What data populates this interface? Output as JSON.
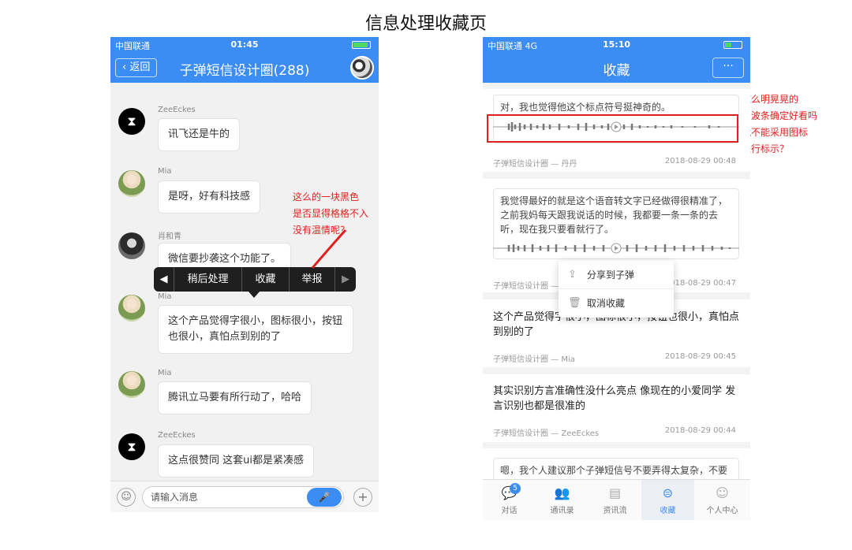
{
  "page_title": "信息处理收藏页",
  "chat_screen": {
    "status": {
      "carrier": "中国联通",
      "time": "01:45"
    },
    "nav": {
      "back_label": "返回",
      "title": "子弹短信设计圈(288)"
    },
    "messages": [
      {
        "sender": "ZeeEckes",
        "text": "讯飞还是牛的"
      },
      {
        "sender": "Mia",
        "text": "是呀，好有科技感"
      },
      {
        "sender": "肖和青",
        "text": "微信要抄袭这个功能了。"
      },
      {
        "sender": "Mia",
        "text": "这个产品觉得字很小，图标很小，按钮也很小，真怕点到别的了"
      },
      {
        "sender": "Mia",
        "text": "腾讯立马要有所行动了，哈哈"
      },
      {
        "sender": "ZeeEckes",
        "text": "这点很赞同 这套ui都是紧凑感"
      }
    ],
    "context_menu": {
      "items": [
        "稍后处理",
        "收藏",
        "举报"
      ]
    },
    "input": {
      "placeholder": "请输入消息"
    }
  },
  "annotations": {
    "left_note_lines": [
      "这么的一块黑色",
      "是否显得格格不入",
      "没有温情呢？"
    ],
    "right_note_lines": [
      "这么明晃晃的",
      "声波条确定好看吗",
      "就不能采用图标",
      "进行标示？"
    ]
  },
  "favorites_screen": {
    "status": {
      "carrier": "中国联通",
      "network": "4G",
      "time": "15:10"
    },
    "nav": {
      "title": "收藏",
      "more_label": "···"
    },
    "items": [
      {
        "quote": "对，我也觉得他这个标点符号挺神奇的。",
        "source": "子弹短信设计圈 — 丹丹",
        "time": "2018-08-29 00:48"
      },
      {
        "quote": "我觉得最好的就是这个语音转文字已经做得很精准了，之前我妈每天跟我说话的时候，我都要一条一条的去听，现在我只要看就行了。",
        "source": "子弹短信设计圈 — 子弹",
        "time": "2018-08-29 00:47"
      },
      {
        "text": "这个产品觉得字很小，图标很小，按钮也很小，真怕点到别的了",
        "source": "子弹短信设计圈 — Mia",
        "time": "2018-08-29 00:45"
      },
      {
        "text": "其实识别方言准确性没什么亮点 像现在的小爱同学 发言识别也都是很准的",
        "source": "子弹短信设计圈 — ZeeEckes",
        "time": "2018-08-29 00:44"
      },
      {
        "quote": "嗯，我个人建议那个子弹短信号不要弄得太复杂，不要"
      }
    ],
    "popup_menu": {
      "share_label": "分享到子弹",
      "cancel_label": "取消收藏"
    },
    "tabs": [
      {
        "label": "对话",
        "badge": "5"
      },
      {
        "label": "通讯录"
      },
      {
        "label": "资讯流"
      },
      {
        "label": "收藏"
      },
      {
        "label": "个人中心"
      }
    ]
  }
}
